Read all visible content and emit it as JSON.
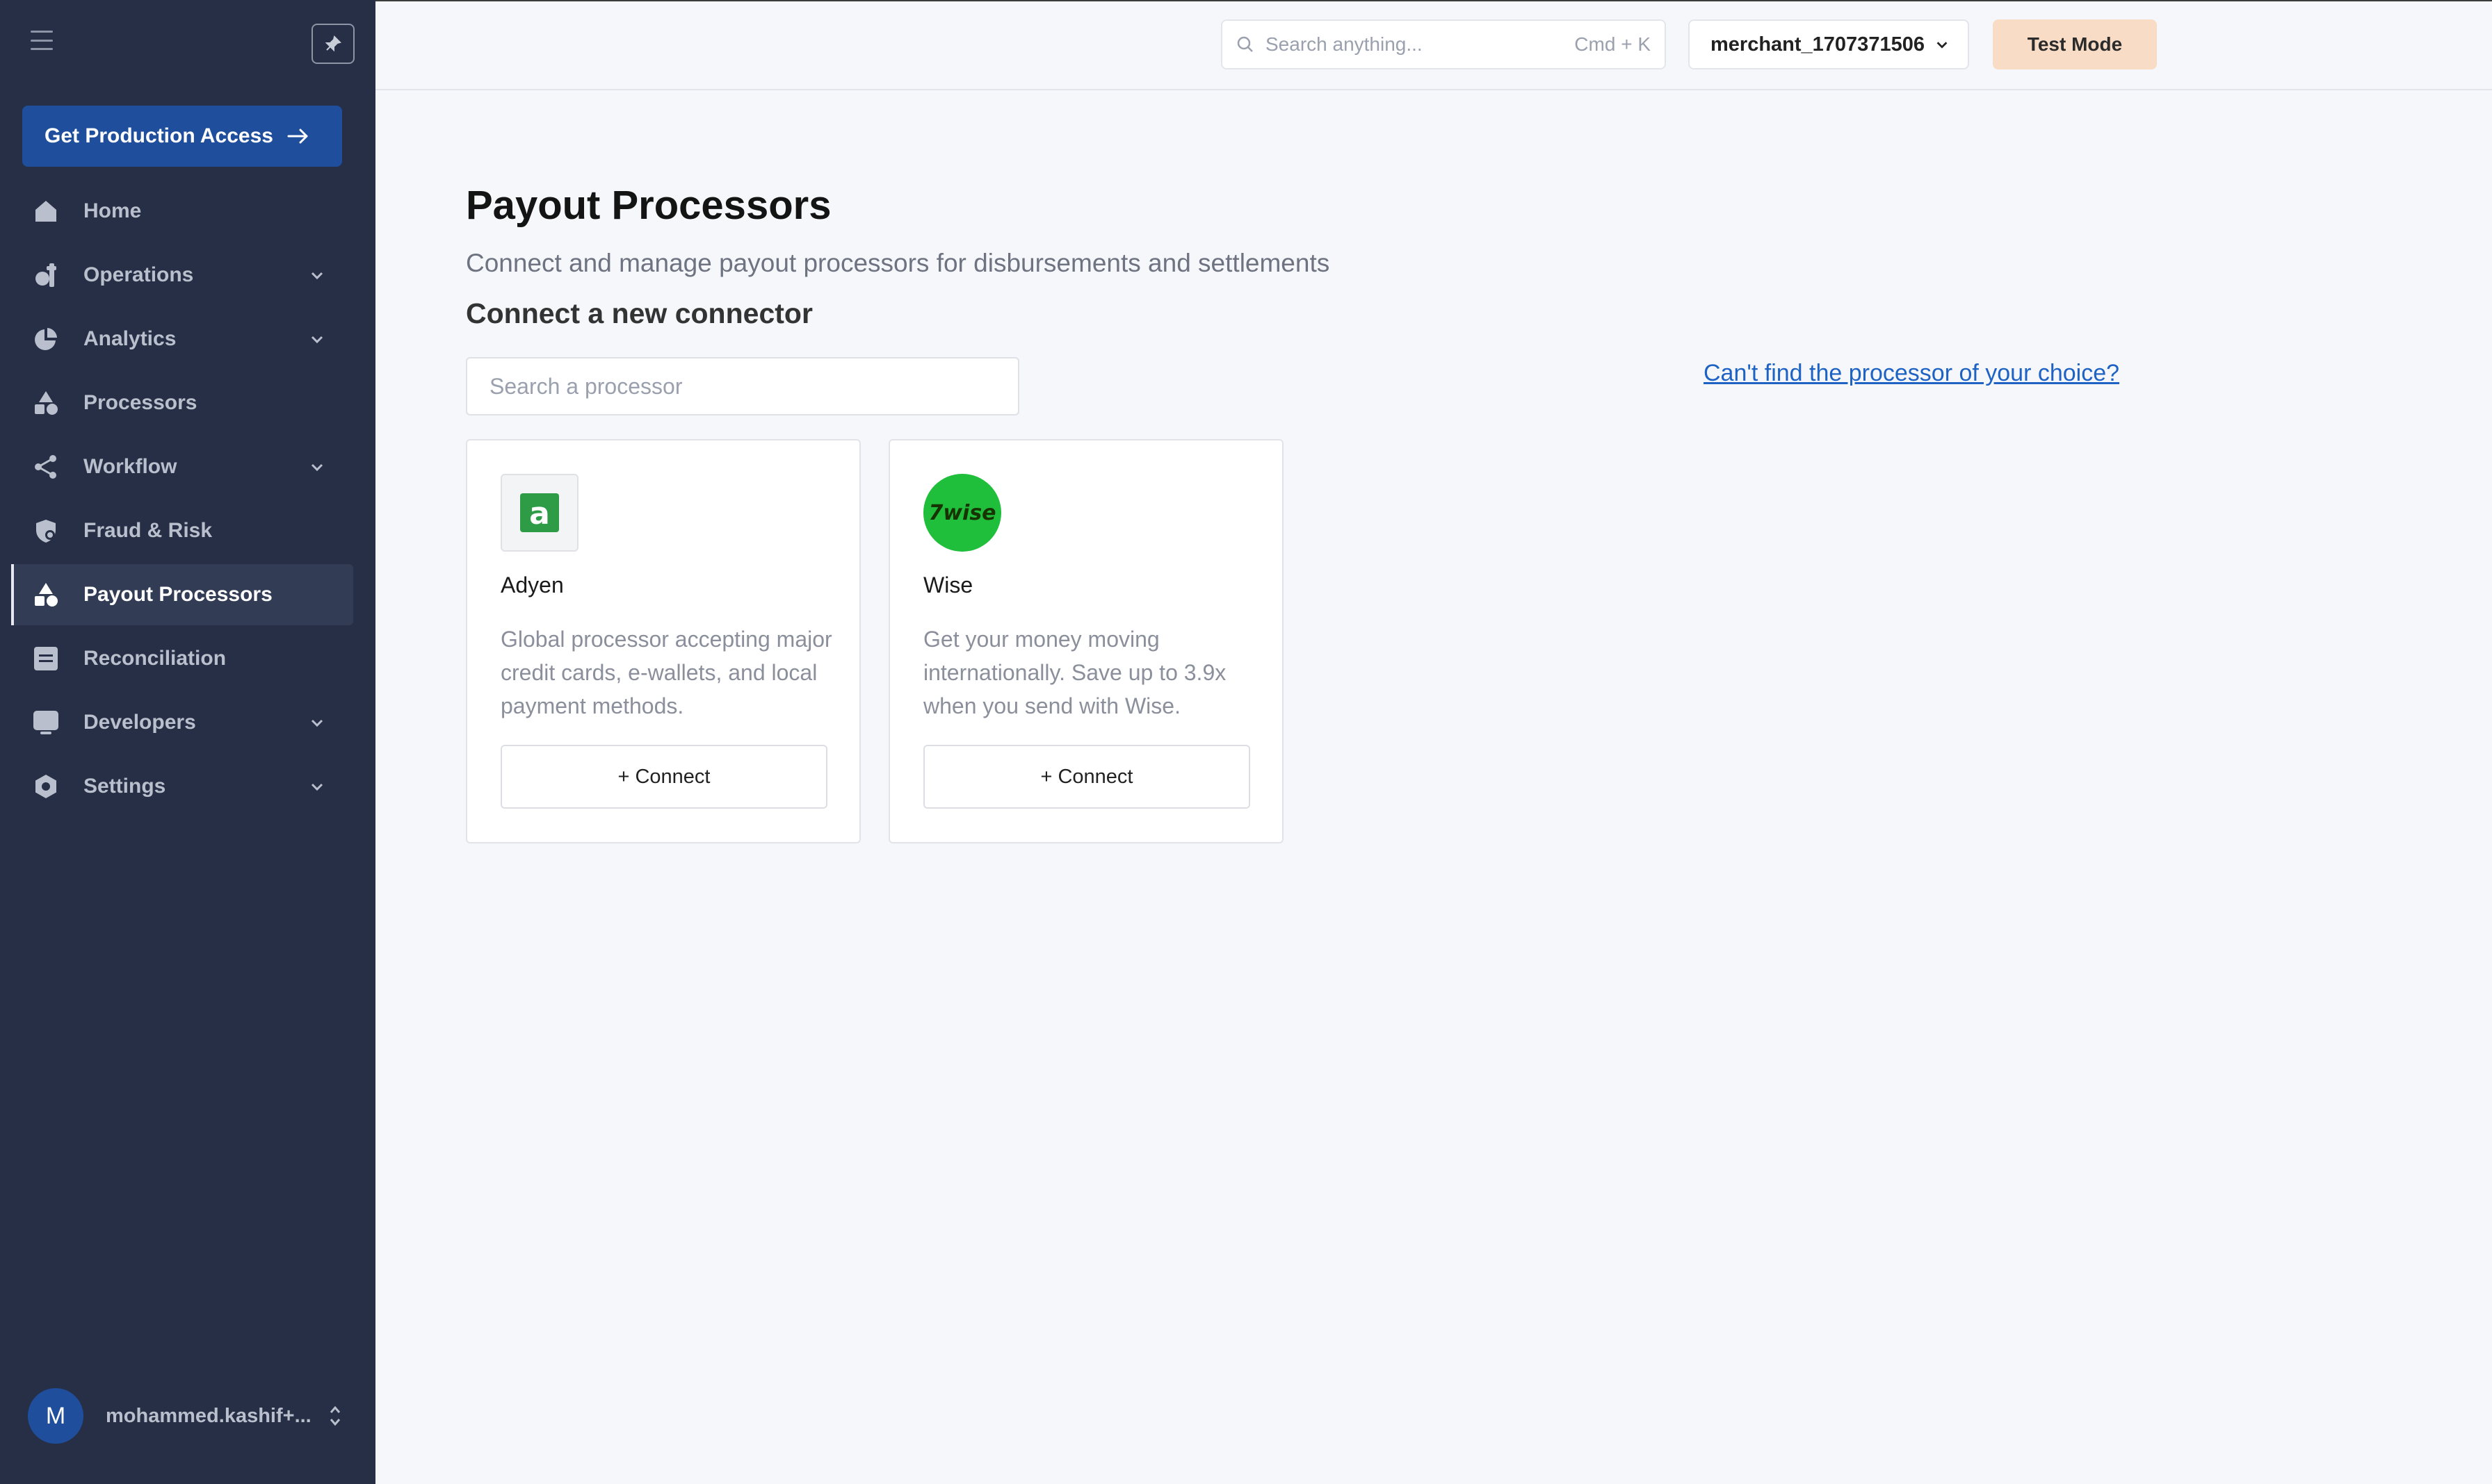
{
  "sidebar": {
    "production_button": "Get Production Access",
    "items": [
      {
        "label": "Home",
        "icon": "home-icon",
        "has_chevron": false
      },
      {
        "label": "Operations",
        "icon": "operations-icon",
        "has_chevron": true
      },
      {
        "label": "Analytics",
        "icon": "analytics-icon",
        "has_chevron": true
      },
      {
        "label": "Processors",
        "icon": "processors-icon",
        "has_chevron": false
      },
      {
        "label": "Workflow",
        "icon": "workflow-icon",
        "has_chevron": true
      },
      {
        "label": "Fraud & Risk",
        "icon": "fraud-risk-icon",
        "has_chevron": false
      },
      {
        "label": "Payout Processors",
        "icon": "payout-processors-icon",
        "has_chevron": false,
        "active": true
      },
      {
        "label": "Reconciliation",
        "icon": "reconciliation-icon",
        "has_chevron": false
      },
      {
        "label": "Developers",
        "icon": "developers-icon",
        "has_chevron": true
      },
      {
        "label": "Settings",
        "icon": "settings-icon",
        "has_chevron": true
      }
    ],
    "user": {
      "initial": "M",
      "name": "mohammed.kashif+..."
    }
  },
  "topbar": {
    "search_placeholder": "Search anything...",
    "search_shortcut": "Cmd + K",
    "merchant": "merchant_1707371506",
    "mode": "Test Mode"
  },
  "main": {
    "title": "Payout Processors",
    "subtitle": "Connect and manage payout processors for disbursements and settlements",
    "section_title": "Connect a new connector",
    "search_placeholder": "Search a processor",
    "cant_find_link": "Can't find the processor of your choice?",
    "connectors": [
      {
        "name": "Adyen",
        "logo_text": "a",
        "description": "Global processor accepting major credit cards, e-wallets, and local payment methods.",
        "button": "+ Connect"
      },
      {
        "name": "Wise",
        "logo_text": "7wise",
        "description": "Get your money moving internationally. Save up to 3.9x when you send with Wise.",
        "button": "+ Connect"
      }
    ]
  },
  "colors": {
    "sidebar_bg": "#262f45",
    "primary": "#1e4e9c",
    "test_mode_bg": "#f9dcc6",
    "link": "#1e63c4",
    "wise_green": "#1fbe3b",
    "adyen_green": "#2e9b46"
  }
}
